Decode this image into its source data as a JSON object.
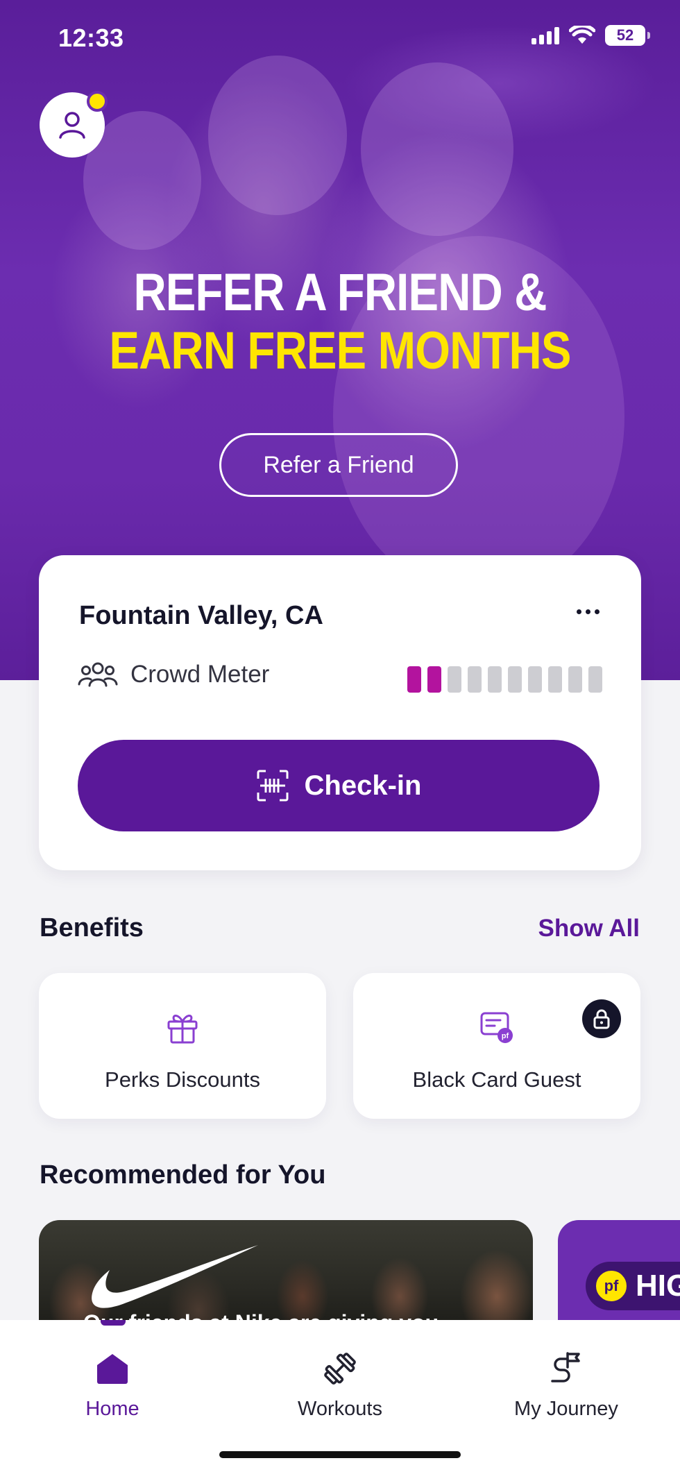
{
  "status_bar": {
    "time": "12:33",
    "battery": "52"
  },
  "hero": {
    "title_line1": "REFER A FRIEND &",
    "title_line2": "EARN FREE MONTHS",
    "refer_button": "Refer a Friend"
  },
  "gym_card": {
    "location": "Fountain Valley, CA",
    "crowd_label": "Crowd Meter",
    "crowd_level": 2,
    "crowd_max": 10,
    "checkin_label": "Check-in"
  },
  "benefits": {
    "title": "Benefits",
    "show_all": "Show All",
    "items": [
      {
        "label": "Perks Discounts",
        "icon": "gift-icon",
        "locked": false
      },
      {
        "label": "Black Card Guest",
        "icon": "guest-pass-icon",
        "locked": true
      }
    ]
  },
  "recommended": {
    "title": "Recommended for You",
    "cards": [
      {
        "caption": "Our friends at Nike are giving you"
      },
      {
        "badge": "pf",
        "caption": "HIG"
      }
    ]
  },
  "tabbar": {
    "tabs": [
      {
        "label": "Home",
        "icon": "home-icon",
        "active": true
      },
      {
        "label": "Workouts",
        "icon": "dumbbell-icon",
        "active": false
      },
      {
        "label": "My Journey",
        "icon": "journey-icon",
        "active": false
      }
    ]
  },
  "colors": {
    "brand_purple": "#5a1899",
    "hero_purple": "#6c2db0",
    "accent_yellow": "#ffe500",
    "crowd_active": "#b3139e",
    "crowd_inactive": "#cdcdd2"
  }
}
